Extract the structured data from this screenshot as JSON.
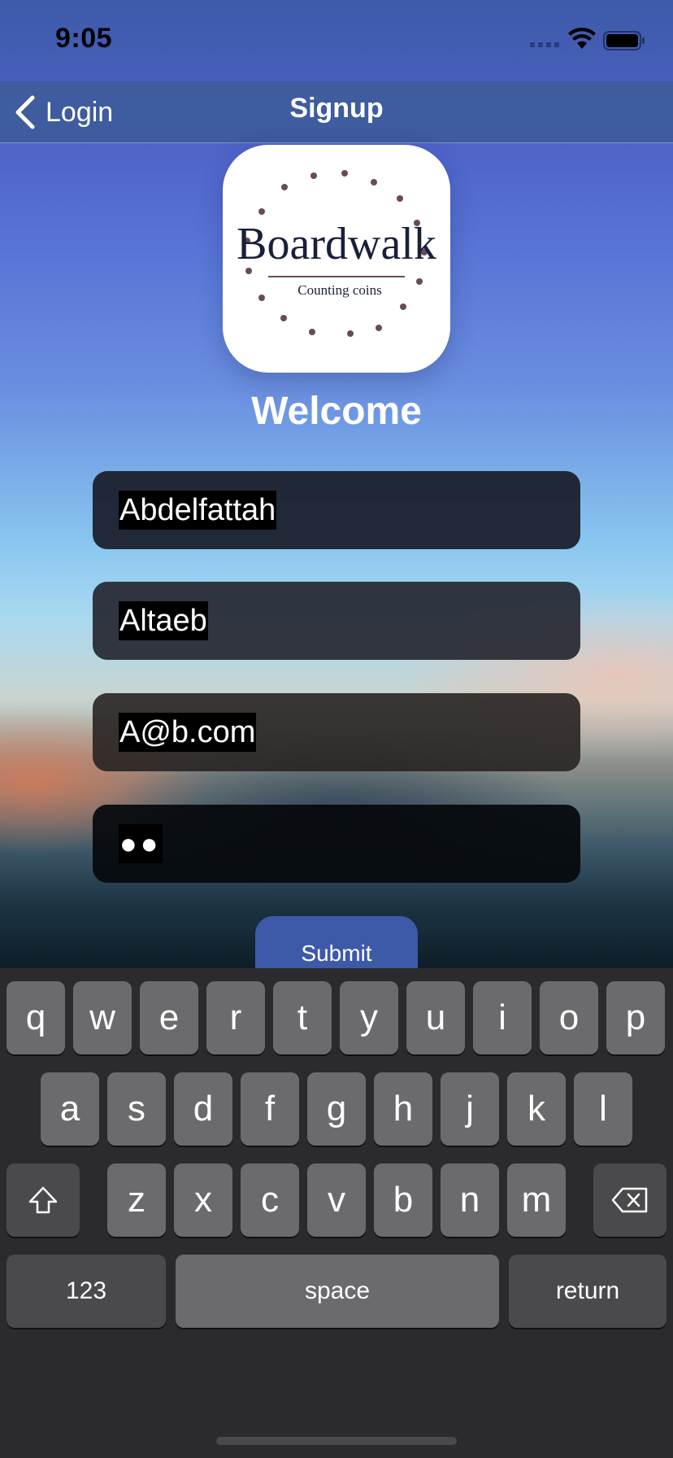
{
  "status": {
    "time": "9:05"
  },
  "nav": {
    "back_label": "Login",
    "title": "Signup"
  },
  "logo": {
    "name": "Boardwalk",
    "tagline": "Counting coins"
  },
  "welcome": "Welcome",
  "form": {
    "first_name": "Abdelfattah",
    "last_name": "Altaeb",
    "email": "A@b.com",
    "password_mask": "●●",
    "submit_label": "Submit"
  },
  "keyboard": {
    "row1": [
      "q",
      "w",
      "e",
      "r",
      "t",
      "y",
      "u",
      "i",
      "o",
      "p"
    ],
    "row2": [
      "a",
      "s",
      "d",
      "f",
      "g",
      "h",
      "j",
      "k",
      "l"
    ],
    "row3": [
      "z",
      "x",
      "c",
      "v",
      "b",
      "n",
      "m"
    ],
    "numbers_label": "123",
    "space_label": "space",
    "return_label": "return"
  },
  "colors": {
    "nav_bar": "#3e5c9e",
    "submit": "#3d5aa8",
    "logo_text": "#1a1f3a",
    "logo_dots": "#6a4a5a"
  },
  "icons": [
    "back-chevron-icon",
    "signal-icon",
    "wifi-icon",
    "battery-icon",
    "shift-icon",
    "delete-icon"
  ]
}
